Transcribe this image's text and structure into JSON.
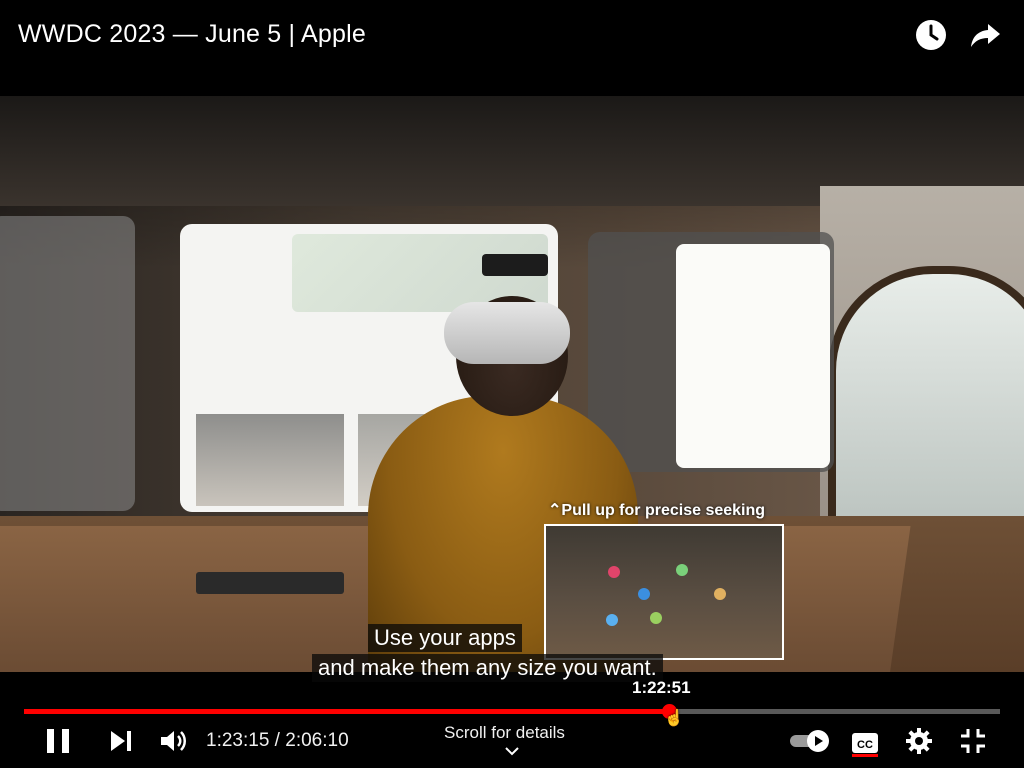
{
  "header": {
    "video_title": "WWDC 2023 — June 5 | Apple",
    "icons": {
      "watch_later": "clock-icon",
      "share": "share-arrow-icon"
    }
  },
  "overlay": {
    "seek_hint": "⌃Pull up for precise seeking",
    "seek_preview_time": "1:22:51"
  },
  "captions": {
    "line1": "Use your apps",
    "line2": "and make them any size you want."
  },
  "player": {
    "progress_fraction": 0.6606,
    "current_time": "1:23:15",
    "duration": "2:06:10",
    "time_separator": " / ",
    "scroll_hint": "Scroll for details",
    "accent_color": "#ff0000",
    "icons": {
      "pause": "pause-icon",
      "next": "next-track-icon",
      "volume": "volume-icon",
      "autoplay": "autoplay-toggle-icon",
      "captions": "closed-captions-icon",
      "settings": "gear-icon",
      "exit_fullscreen": "exit-fullscreen-icon",
      "chevron": "chevron-down-icon"
    }
  }
}
